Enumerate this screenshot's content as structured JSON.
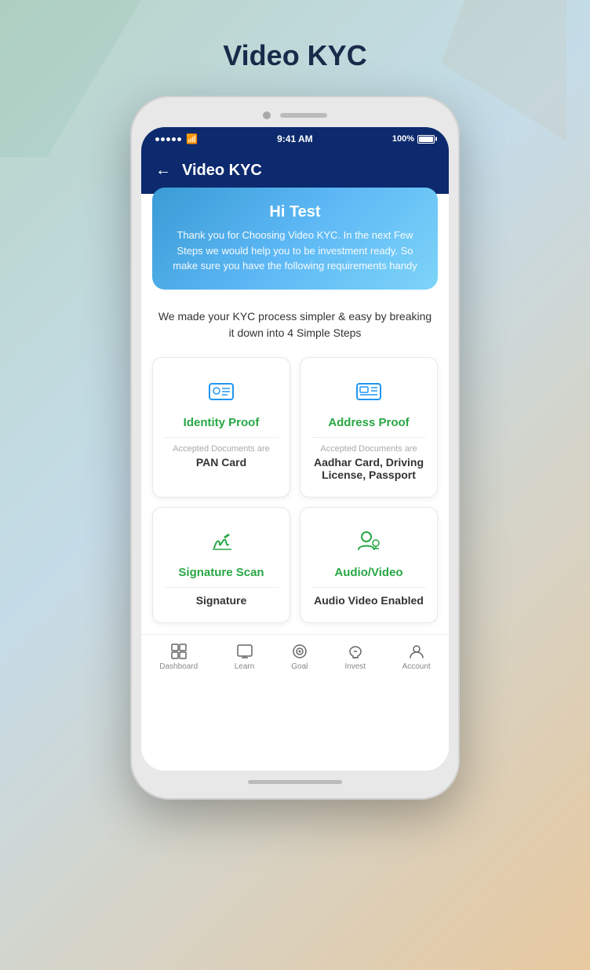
{
  "page": {
    "title": "Video KYC",
    "background_colors": [
      "#b8d4c8",
      "#c5dce8",
      "#e8c9a0"
    ]
  },
  "status_bar": {
    "time": "9:41 AM",
    "battery": "100%",
    "signal_dots": 5
  },
  "header": {
    "back_label": "←",
    "title": "Video KYC"
  },
  "welcome_card": {
    "greeting": "Hi Test",
    "message": "Thank you for Choosing Video KYC. In the next Few Steps we would help you to be investment ready. So make sure you have the following requirements handy"
  },
  "info_text": "We made your KYC process simpler & easy by breaking it down into 4 Simple Steps",
  "steps": [
    {
      "id": "identity-proof",
      "title": "Identity Proof",
      "doc_label": "Accepted Documents are",
      "doc_value": "PAN Card",
      "icon": "id-card"
    },
    {
      "id": "address-proof",
      "title": "Address Proof",
      "doc_label": "Accepted Documents are",
      "doc_value": "Aadhar Card, Driving License, Passport",
      "icon": "id-badge"
    },
    {
      "id": "signature-scan",
      "title": "Signature Scan",
      "doc_label": "",
      "doc_value": "Signature",
      "icon": "pen-signature"
    },
    {
      "id": "audio-video",
      "title": "Audio/Video",
      "doc_label": "",
      "doc_value": "Audio Video Enabled",
      "icon": "video-user"
    }
  ],
  "bottom_nav": [
    {
      "id": "dashboard",
      "label": "Dashboard",
      "icon": "grid"
    },
    {
      "id": "learn",
      "label": "Learn",
      "icon": "monitor"
    },
    {
      "id": "goal",
      "label": "Goal",
      "icon": "target"
    },
    {
      "id": "invest",
      "label": "Invest",
      "icon": "piggy-bank"
    },
    {
      "id": "account",
      "label": "Account",
      "icon": "user"
    }
  ]
}
